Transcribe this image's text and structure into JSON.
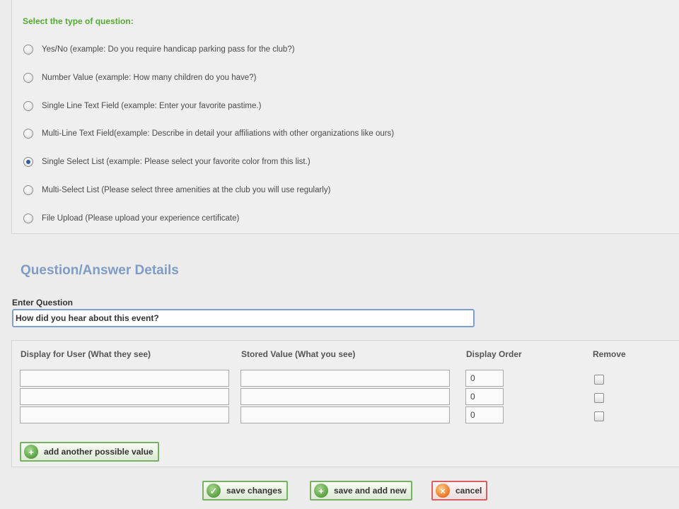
{
  "question_type": {
    "label": "Select the type of question:",
    "options": [
      {
        "label": "Yes/No (example: Do you require handicap parking pass for the club?)",
        "selected": false
      },
      {
        "label": "Number Value (example: How many children do you have?)",
        "selected": false
      },
      {
        "label": "Single Line Text Field (example: Enter your favorite pastime.)",
        "selected": false
      },
      {
        "label": "Multi-Line Text Field(example: Describe in detail your affiliations with other organizations like ours)",
        "selected": false
      },
      {
        "label": "Single Select List (example: Please select your favorite color from this list.)",
        "selected": true
      },
      {
        "label": "Multi-Select List (Please select three amenities at the club you will use regularly)",
        "selected": false
      },
      {
        "label": "File Upload (Please upload your experience certificate)",
        "selected": false
      }
    ]
  },
  "details": {
    "heading": "Question/Answer Details",
    "question_label": "Enter Question",
    "question_value": "How did you hear about this event?"
  },
  "values_table": {
    "headers": {
      "display": "Display for User (What they see)",
      "stored": "Stored Value (What you see)",
      "order": "Display Order",
      "remove": "Remove"
    },
    "rows": [
      {
        "display": "",
        "stored": "",
        "order": "0",
        "remove": false
      },
      {
        "display": "",
        "stored": "",
        "order": "0",
        "remove": false
      },
      {
        "display": "",
        "stored": "",
        "order": "0",
        "remove": false
      }
    ],
    "add_label": "add another possible value"
  },
  "actions": {
    "save_changes": "save changes",
    "save_and_add_new": "save and add new",
    "cancel": "cancel"
  }
}
